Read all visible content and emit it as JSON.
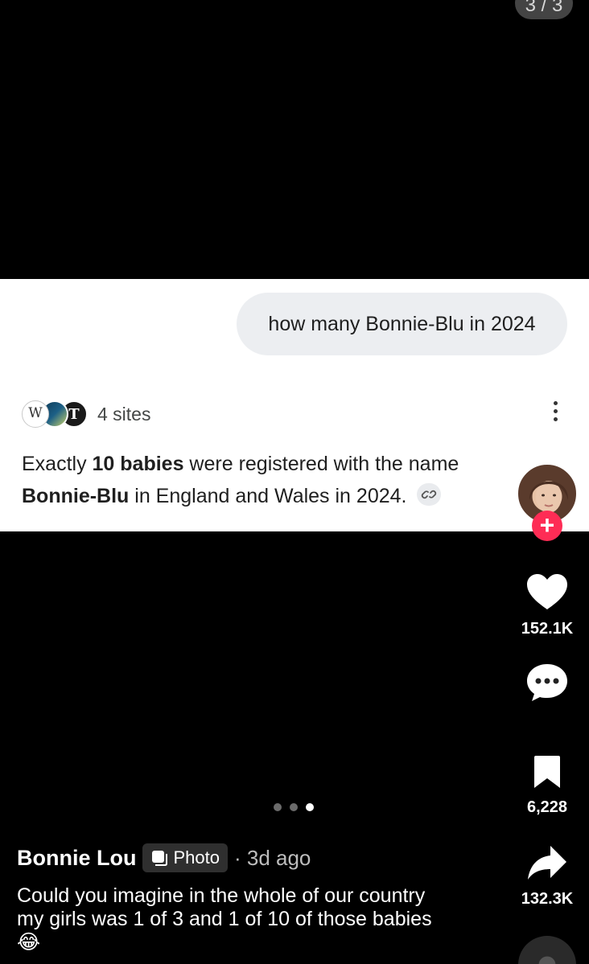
{
  "counter": "3 / 3",
  "screenshot": {
    "query": "how many Bonnie-Blu in 2024",
    "sources_label": "4 sites",
    "answer": {
      "part1": "Exactly ",
      "bold1": "10 babies",
      "part2": " were registered with the name ",
      "bold2": "Bonnie-Blu",
      "part3": " in England and Wales in 2024."
    }
  },
  "rail": {
    "likes": "152.1K",
    "saves": "6,228",
    "shares": "132.3K"
  },
  "post": {
    "author": "Bonnie Lou",
    "badge": "Photo",
    "age": "· 3d ago",
    "caption": "Could you imagine in the whole of our country my girls was 1 of 3 and 1 of 10 of those babies 😂"
  },
  "colors": {
    "follow_accent": "#fe2c55",
    "bubble_bg": "#eceef1"
  }
}
